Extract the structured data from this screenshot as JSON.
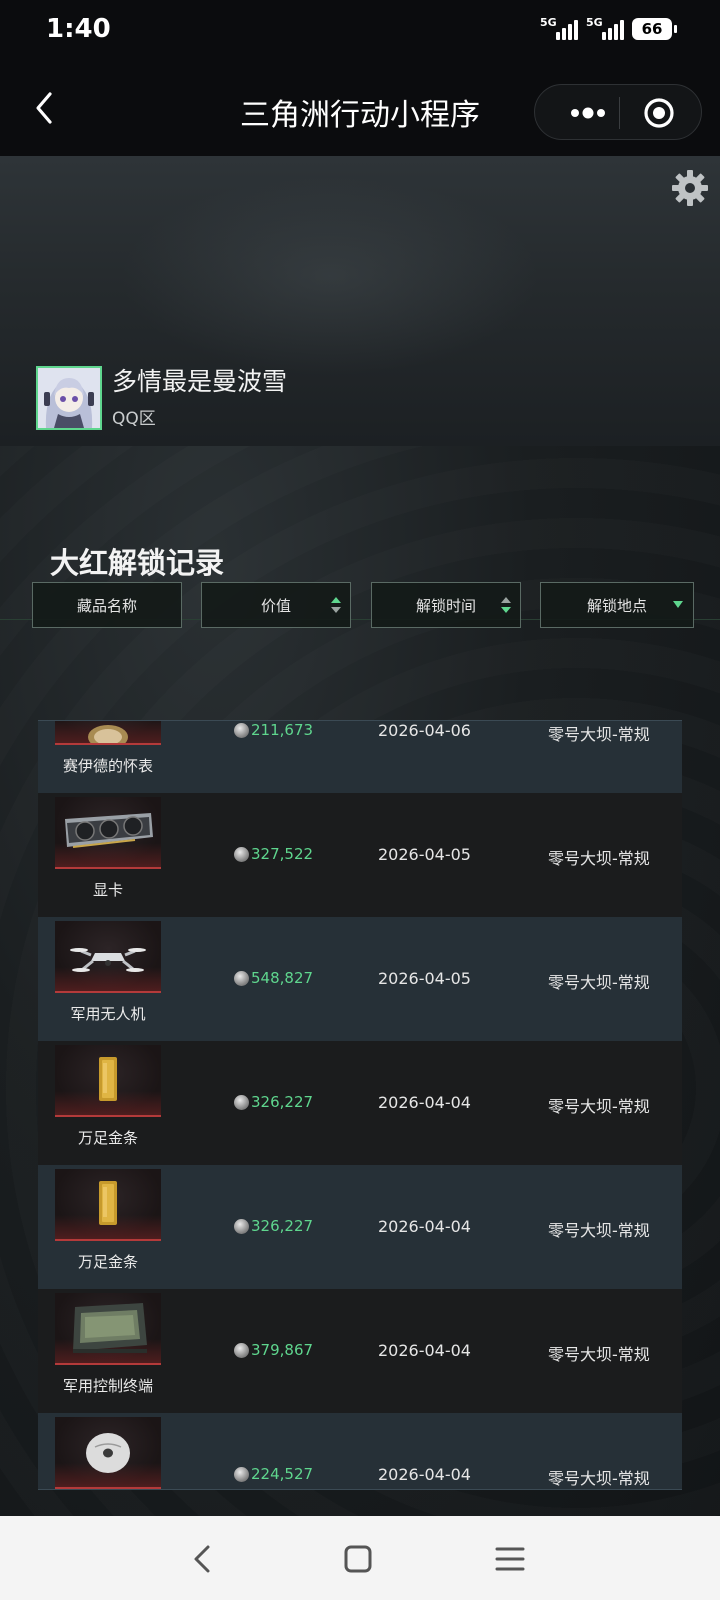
{
  "status_bar": {
    "time": "1:40",
    "network_1": "5G",
    "network_2": "5G",
    "battery": "66"
  },
  "titlebar": {
    "title": "三角洲行动小程序",
    "icons": [
      "back-arrow-icon",
      "more-dots-icon",
      "target-icon"
    ]
  },
  "profile": {
    "username": "多情最是曼波雪",
    "region": "QQ区",
    "accent": "#5fd68e"
  },
  "section": {
    "title": "大红解锁记录"
  },
  "table": {
    "columns": [
      "藏品名称",
      "价值",
      "解锁时间",
      "解锁地点"
    ],
    "rows": [
      {
        "name": "赛伊德的怀表",
        "value": "211,673",
        "date": "2026-04-06",
        "location": "零号大坝-常规",
        "icon": "pocket-watch"
      },
      {
        "name": "显卡",
        "value": "327,522",
        "date": "2026-04-05",
        "location": "零号大坝-常规",
        "icon": "graphics-card"
      },
      {
        "name": "军用无人机",
        "value": "548,827",
        "date": "2026-04-05",
        "location": "零号大坝-常规",
        "icon": "drone"
      },
      {
        "name": "万足金条",
        "value": "326,227",
        "date": "2026-04-04",
        "location": "零号大坝-常规",
        "icon": "gold-bar"
      },
      {
        "name": "万足金条",
        "value": "326,227",
        "date": "2026-04-04",
        "location": "零号大坝-常规",
        "icon": "gold-bar"
      },
      {
        "name": "军用控制终端",
        "value": "379,867",
        "date": "2026-04-04",
        "location": "零号大坝-常规",
        "icon": "control-terminal"
      },
      {
        "name": "",
        "value": "224,527",
        "date": "2026-04-04",
        "location": "零号大坝-常规",
        "icon": "disc"
      }
    ],
    "value_color": "#5fd68e"
  },
  "navbar": {
    "icons": [
      "nav-back-icon",
      "nav-home-icon",
      "nav-menu-icon"
    ]
  }
}
